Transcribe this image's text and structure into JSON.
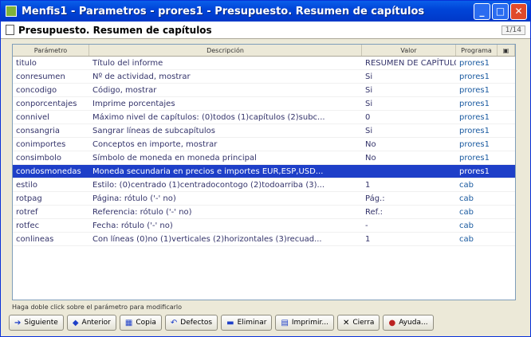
{
  "window": {
    "title": "Menfis1 - Parametros - prores1 - Presupuesto. Resumen de capítulos"
  },
  "header": {
    "title": "Presupuesto. Resumen de capítulos",
    "page": "1/14"
  },
  "columns": {
    "param": "Parámetro",
    "desc": "Descripción",
    "value": "Valor",
    "program": "Programa"
  },
  "rows": [
    {
      "param": "titulo",
      "desc": "Título del informe",
      "value": "RESUMEN DE CAPÍTULOS",
      "program": "prores1"
    },
    {
      "param": "conresumen",
      "desc": "Nº de actividad, mostrar",
      "value": "Si",
      "program": "prores1"
    },
    {
      "param": "concodigo",
      "desc": "Código, mostrar",
      "value": "Si",
      "program": "prores1"
    },
    {
      "param": "conporcentajes",
      "desc": "Imprime porcentajes",
      "value": "Si",
      "program": "prores1"
    },
    {
      "param": "connivel",
      "desc": "Máximo nivel de capítulos: (0)todos (1)capítulos (2)subc...",
      "value": "0",
      "program": "prores1"
    },
    {
      "param": "consangria",
      "desc": "Sangrar líneas de subcapítulos",
      "value": "Si",
      "program": "prores1"
    },
    {
      "param": "conimportes",
      "desc": "Conceptos en importe, mostrar",
      "value": "No",
      "program": "prores1"
    },
    {
      "param": "consimbolo",
      "desc": "Símbolo de moneda en moneda principal",
      "value": "No",
      "program": "prores1"
    },
    {
      "param": "condosmonedas",
      "desc": "Moneda secundaria en precios e importes EUR,ESP,USD...",
      "value": "",
      "program": "prores1"
    },
    {
      "param": "estilo",
      "desc": "Estilo: (0)centrado (1)centradocontogo (2)todoarriba (3)...",
      "value": "1",
      "program": "cab"
    },
    {
      "param": "rotpag",
      "desc": "Página: rótulo ('-' no)",
      "value": "Pág.:",
      "program": "cab"
    },
    {
      "param": "rotref",
      "desc": "Referencia: rótulo ('-' no)",
      "value": "Ref.:",
      "program": "cab"
    },
    {
      "param": "rotfec",
      "desc": "Fecha: rótulo ('-' no)",
      "value": "-",
      "program": "cab"
    },
    {
      "param": "conlineas",
      "desc": "Con líneas (0)no (1)verticales (2)horizontales (3)recuad...",
      "value": "1",
      "program": "cab"
    }
  ],
  "hint": "Haga doble click sobre el parámetro para modificarlo",
  "toolbar": {
    "siguiente": "Siguiente",
    "anterior": "Anterior",
    "copia": "Copia",
    "defectos": "Defectos",
    "eliminar": "Eliminar",
    "imprimir": "Imprimir...",
    "cierra": "Cierra",
    "ayuda": "Ayuda..."
  }
}
